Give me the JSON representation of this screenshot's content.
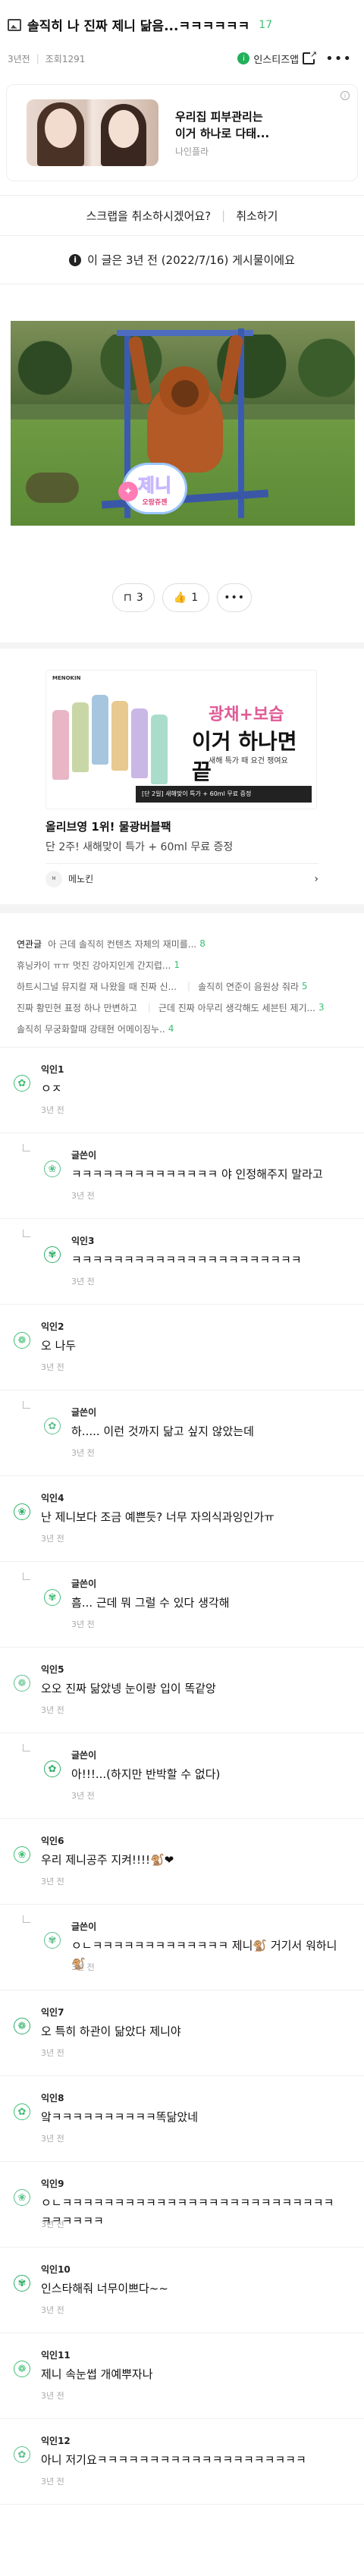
{
  "header": {
    "title": "솔직히 나 진짜 제니 닮음...ㅋㅋㅋㅋㅋㅋ",
    "comment_count": "17",
    "posted_ago": "3년전",
    "views": "조회1291",
    "board_name": "인스티즈앱",
    "board_badge": "i"
  },
  "ad_top": {
    "line1": "우리집 피부관리는",
    "line2": "이거 하나로 다태...",
    "brand": "나인플라"
  },
  "scrap": {
    "question": "스크랩을 취소하시겠어요?",
    "cancel": "취소하기"
  },
  "notice": {
    "text": "이 글은 3년 전 (2022/7/16) 게시물이에요"
  },
  "post_image": {
    "name_tag": "제니",
    "name_sub": "오랑쥬젠"
  },
  "reactions": {
    "scrap_count": "3",
    "like_count": "1"
  },
  "ad_mid": {
    "tag": "MENOKIN",
    "headline_top": "광채+보습",
    "headline_main": "이거 하나면 끝",
    "headline_sub": "새해 특가 때 요건 쟁여요",
    "strip": "[단 2일] 새해맞이 특가 + 60ml 무료 증정",
    "title": "올리브영 1위! 물광버블팩",
    "desc": "단 2주! 새해맞이 특가 + 60ml 무료 증정",
    "brand": "메노킨"
  },
  "related": {
    "label": "연관글",
    "items": [
      {
        "text": "아 근데 솔직히 컨텐츠 자체의 재미를...",
        "count": "8"
      },
      {
        "text": "휴닝카이 ㅠㅠ 멋진 강아지인게 간지럽...",
        "count": "1"
      },
      {
        "text": "하트시그널 뮤지컬 재 나왔을 때 진짜 신...",
        "count": ""
      },
      {
        "text": "솔직히 연준이 음원상 줘라",
        "count": "5"
      },
      {
        "text": "진짜 황민현 표정 하나 만변하고",
        "count": ""
      },
      {
        "text": "근데 진짜 아무리 생각해도 세븐틴 제기...",
        "count": "3"
      },
      {
        "text": "솔직히 무궁화할때 강태현 어메이징누..",
        "count": "4"
      }
    ]
  },
  "comments": [
    {
      "nick": "익인1",
      "body": "ㅇㅈ",
      "time": "3년 전",
      "reply": false
    },
    {
      "nick": "글쓴이",
      "body": "ㅋㅋㅋㅋㅋㅋㅋㅋㅋㅋㅋㅋㅋㅋ 야 인정해주지 말라고",
      "time": "3년 전",
      "reply": true
    },
    {
      "nick": "익인3",
      "body": "ㅋㅋㅋㅋㅋㅋㅋㅋㅋㅋㅋㅋㅋㅋㅋㅋㅋㅋㅋㅋㅋㅋ",
      "time": "3년 전",
      "reply": true
    },
    {
      "nick": "익인2",
      "body": "오 나두",
      "time": "3년 전",
      "reply": false
    },
    {
      "nick": "글쓴이",
      "body": "하..... 이런 것까지 닮고 싶지 않았는데",
      "time": "3년 전",
      "reply": true
    },
    {
      "nick": "익인4",
      "body": "난 제니보다 조금 예쁜듯? 너무 자의식과잉인가ㅠ",
      "time": "3년 전",
      "reply": false
    },
    {
      "nick": "글쓴이",
      "body": "흠... 근데 뭐 그럴 수 있다 생각해",
      "time": "3년 전",
      "reply": true
    },
    {
      "nick": "익인5",
      "body": "오오 진짜 닮았넹 눈이랑 입이 똑같앙",
      "time": "3년 전",
      "reply": false
    },
    {
      "nick": "글쓴이",
      "body": "아!!!...(하지만 반박할 수 없다)",
      "time": "3년 전",
      "reply": true
    },
    {
      "nick": "익인6",
      "body": "우리 제니공주 지켜!!!!🐒❤",
      "time": "3년 전",
      "reply": false
    },
    {
      "nick": "글쓴이",
      "body": "ㅇㄴㅋㅋㅋㅋㅋㅋㅋㅋㅋㅋㅋㅋㅋ 제니🐒 거기서 워하니🐒",
      "time": "3년 전",
      "reply": true
    },
    {
      "nick": "익인7",
      "body": "오 특히 하관이 닮았다 제니야",
      "time": "3년 전",
      "reply": false
    },
    {
      "nick": "익인8",
      "body": "앜ㅋㅋㅋㅋㅋㅋㅋㅋㅋㅋ똑닮았네",
      "time": "3년 전",
      "reply": false
    },
    {
      "nick": "익인9",
      "body": "ㅇㄴㅋㅋㅋㅋㅋㅋㅋㅋㅋㅋㅋㅋㅋㅋㅋㅋㅋㅋㅋㅋㅋㅋㅋㅋㅋㅋㅋㅋㅋㅋㅋㅋ",
      "time": "3년 전",
      "reply": false
    },
    {
      "nick": "익인10",
      "body": "인스타해줘 너무이쁘다~~",
      "time": "3년 전",
      "reply": false
    },
    {
      "nick": "익인11",
      "body": "제니 속눈썹 개예뿌자나",
      "time": "3년 전",
      "reply": false
    },
    {
      "nick": "익인12",
      "body": "아니 저기요ㅋㅋㅋㅋㅋㅋㅋㅋㅋㅋㅋㅋㅋㅋㅋㅋㅋㅋㅋㅋ",
      "time": "3년 전",
      "reply": false
    }
  ],
  "colors": {
    "accent_green": "#3fbf74",
    "avatar_green": "#3fbf74",
    "text_dark": "#111111"
  }
}
